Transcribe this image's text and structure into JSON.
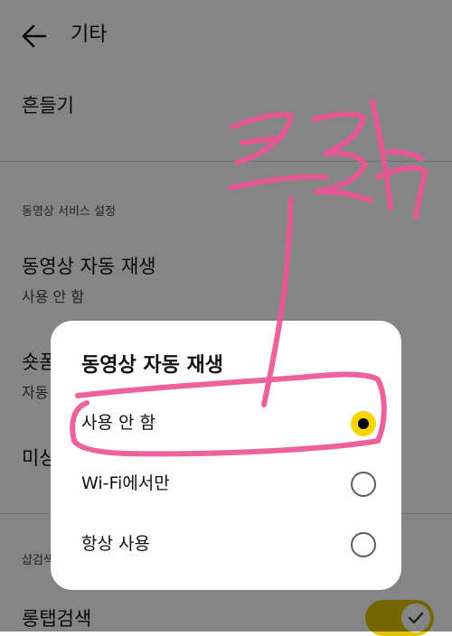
{
  "colors": {
    "accent": "#f6d400",
    "annotation": "#ec5594",
    "toggle_on": "#e3c400"
  },
  "appbar": {
    "title": "기타",
    "back_icon": "arrow-left-icon"
  },
  "settings": {
    "shake": {
      "title": "흔들기"
    },
    "video_section_header": "동영상 서비스 설정",
    "autoplay": {
      "title": "동영상 자동 재생",
      "value": "사용 안 함"
    },
    "shorts": {
      "title_partial": "숏폼",
      "sub_partial": "자동"
    },
    "row_partial": {
      "title_partial": "미상"
    },
    "search_section_header_partial": "샵검색",
    "long_tap_search": {
      "title": "롱탭검색",
      "enabled": true
    }
  },
  "dialog": {
    "title": "동영상 자동 재생",
    "options": [
      {
        "label": "사용 안 함",
        "selected": true
      },
      {
        "label": "Wi-Fi에서만",
        "selected": false
      },
      {
        "label": "항상 사용",
        "selected": false
      }
    ]
  },
  "annotation": {
    "text": "클릭"
  }
}
